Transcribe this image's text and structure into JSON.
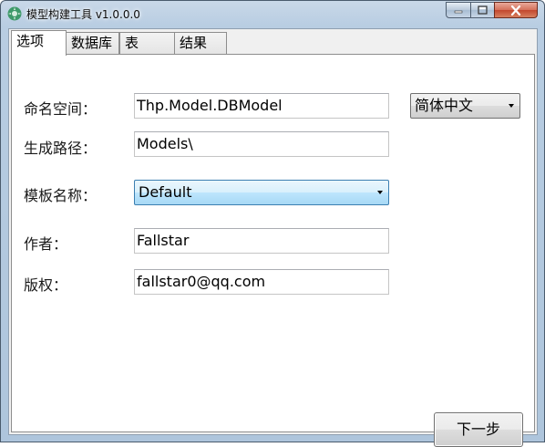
{
  "window": {
    "title": "模型构建工具 v1.0.0.0",
    "controls": {
      "minimize": "minimize-icon",
      "maximize": "maximize-icon",
      "close": "close-icon"
    }
  },
  "tabs": [
    {
      "label": "选项",
      "active": true
    },
    {
      "label": "数据库",
      "active": false
    },
    {
      "label": "表",
      "active": false
    },
    {
      "label": "结果",
      "active": false
    }
  ],
  "form": {
    "namespace_label": "命名空间：",
    "namespace_value": "Thp.Model.DBModel",
    "language_value": "简体中文",
    "output_path_label": "生成路径：",
    "output_path_value": "Models\\",
    "template_label": "模板名称：",
    "template_value": "Default",
    "author_label": "作者：",
    "author_value": "Fallstar",
    "copyright_label": "版权：",
    "copyright_value": "fallstar0@qq.com"
  },
  "next_button": "下一步",
  "colors": {
    "accent_focus": "#3c7fb1",
    "close_button": "#c2472e"
  }
}
